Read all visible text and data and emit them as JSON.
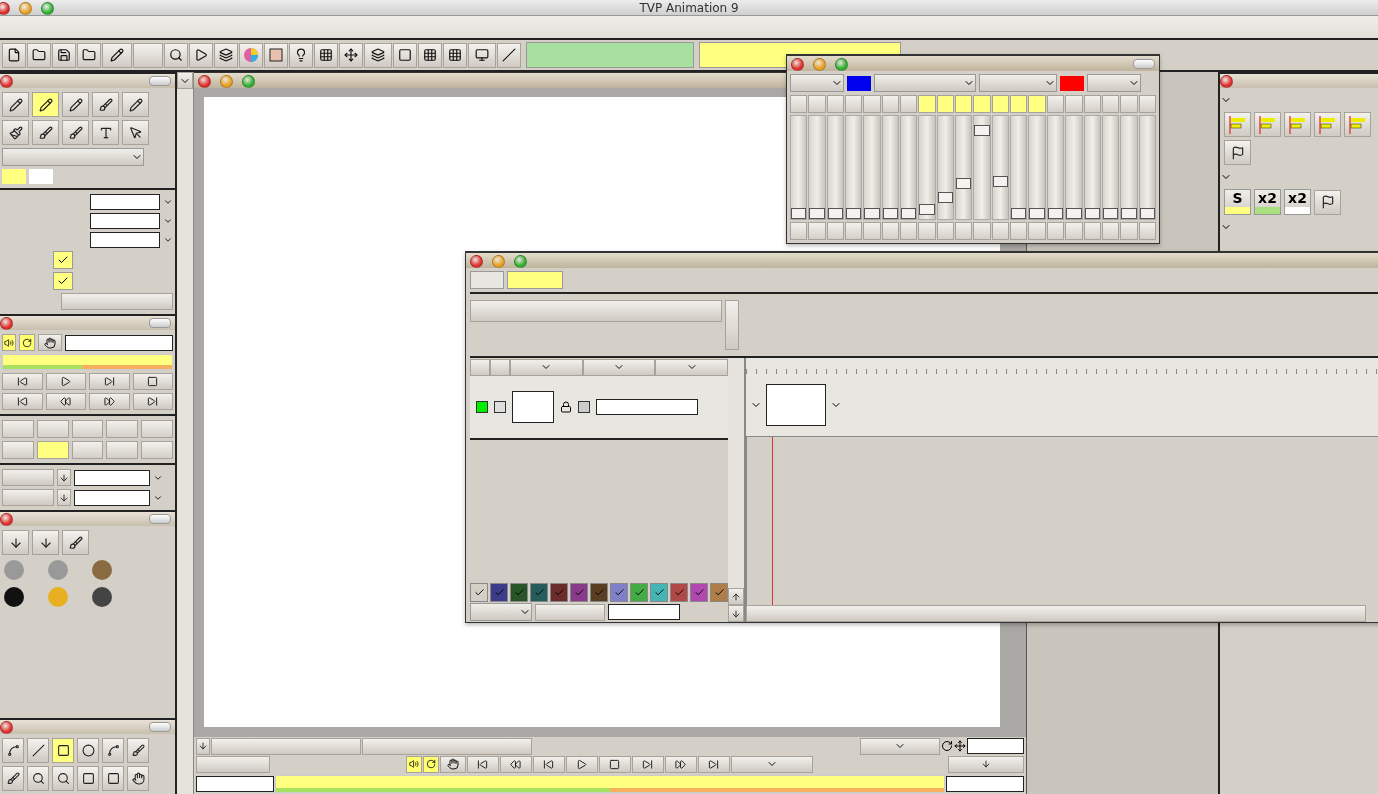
{
  "window": {
    "title": "TVP Animation 9"
  },
  "left_panel": {
    "checkboxes": [
      {
        "checked": true
      },
      {
        "checked": true
      }
    ],
    "grid_cells": [
      {
        "selected": false
      },
      {
        "selected": true
      },
      {
        "selected": false
      },
      {
        "selected": false
      },
      {
        "selected": false
      }
    ],
    "sound_on": true,
    "loop_on": true,
    "progress": {
      "level": 0.47
    }
  },
  "mixer": {
    "swatches": [
      {
        "color": "#0000ee"
      },
      {
        "color": "#ff0000"
      }
    ],
    "channels": [
      {
        "level": 0,
        "selected": false
      },
      {
        "level": 0,
        "selected": false
      },
      {
        "level": 0,
        "selected": false
      },
      {
        "level": 0,
        "selected": false
      },
      {
        "level": 0,
        "selected": false
      },
      {
        "level": 0,
        "selected": false
      },
      {
        "level": 0,
        "selected": false
      },
      {
        "level": 0.04,
        "selected": true
      },
      {
        "level": 0.18,
        "selected": true
      },
      {
        "level": 0.33,
        "selected": true
      },
      {
        "level": 0.92,
        "selected": true
      },
      {
        "level": 0.35,
        "selected": true
      },
      {
        "level": 0,
        "selected": true
      },
      {
        "level": 0,
        "selected": true
      },
      {
        "level": 0,
        "selected": false
      },
      {
        "level": 0,
        "selected": false
      },
      {
        "level": 0,
        "selected": false
      },
      {
        "level": 0,
        "selected": false
      },
      {
        "level": 0,
        "selected": false
      },
      {
        "level": 0,
        "selected": false
      }
    ]
  },
  "timeline": {
    "tabs": [
      {
        "selected": false
      },
      {
        "selected": true
      }
    ],
    "layer": {
      "color": "#00ee00",
      "visible": false,
      "option": false
    },
    "color_tags": [
      {
        "color": "#d4d0c8"
      },
      {
        "color": "#3c3c88"
      },
      {
        "color": "#275527"
      },
      {
        "color": "#275c5c"
      },
      {
        "color": "#6c2c2c"
      },
      {
        "color": "#8a3a8a"
      },
      {
        "color": "#5a3e22"
      },
      {
        "color": "#8080c8"
      },
      {
        "color": "#44aa44"
      },
      {
        "color": "#44b4b4"
      },
      {
        "color": "#b04848"
      },
      {
        "color": "#b048b0"
      },
      {
        "color": "#b07c48"
      }
    ]
  },
  "exposure_buttons": [
    {
      "label": "S"
    },
    {
      "label": "x2"
    },
    {
      "label": "x2"
    }
  ],
  "playback": {
    "sound_on": true,
    "loop_on": true,
    "progress": {
      "level": 0.5
    }
  }
}
